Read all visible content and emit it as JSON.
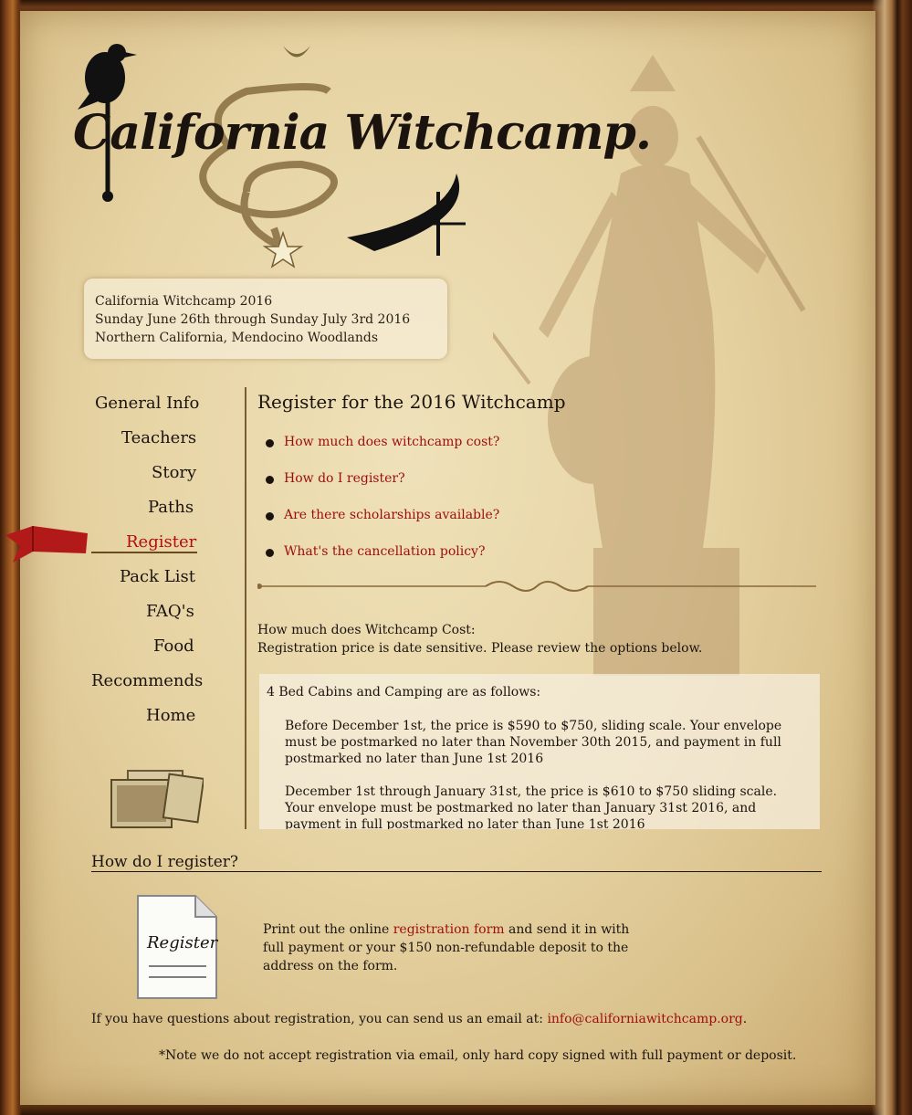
{
  "site": {
    "logo_text": "California Witchcamp."
  },
  "banner": {
    "line1": "California Witchcamp 2016",
    "line2": "Sunday June 26th through Sunday July 3rd 2016",
    "line3": "Northern California, Mendocino Woodlands"
  },
  "nav": {
    "items": [
      {
        "label": "General Info"
      },
      {
        "label": "Teachers"
      },
      {
        "label": "Story"
      },
      {
        "label": "Paths"
      },
      {
        "label": "Register"
      },
      {
        "label": "Pack List"
      },
      {
        "label": "FAQ's"
      },
      {
        "label": "Food"
      },
      {
        "label": "Recommends"
      },
      {
        "label": "Home"
      }
    ],
    "active": "Register"
  },
  "main": {
    "title": "Register for the 2016 Witchcamp",
    "faq_links": [
      "How much does witchcamp cost?",
      "How do I register?",
      "Are there scholarships available?",
      "What's the cancellation policy?"
    ],
    "cost_question": "How much does Witchcamp Cost:",
    "cost_note": "Registration price is date sensitive. Please review the options below.",
    "cost_box": {
      "heading": "4 Bed Cabins and Camping are as follows:",
      "para1": "Before December 1st, the price is $590 to $750, sliding scale. Your envelope must be postmarked no later than November 30th 2015, and payment in full postmarked no later than June 1st 2016",
      "para2": "December 1st through January 31st, the price is $610 to $750 sliding scale. Your envelope must be postmarked no later than January 31st 2016, and payment in full postmarked no later than June 1st 2016"
    }
  },
  "how_register": {
    "heading": "How do I register?",
    "doc_label": "Register",
    "text_before": "Print out the online ",
    "link": "registration form",
    "text_after": " and send it in with full payment or your $150 non-refundable deposit to the address on the form."
  },
  "footer": {
    "questions_text": "If you have questions about registration, you can send us an email at: ",
    "email": "info@californiawitchcamp.org",
    "period": ".",
    "note": "*Note we do not accept registration via email, only hard copy signed with full payment or deposit."
  },
  "colors": {
    "link": "#9d0d0d",
    "active_nav": "#b50d0d",
    "text": "#1b140e"
  }
}
